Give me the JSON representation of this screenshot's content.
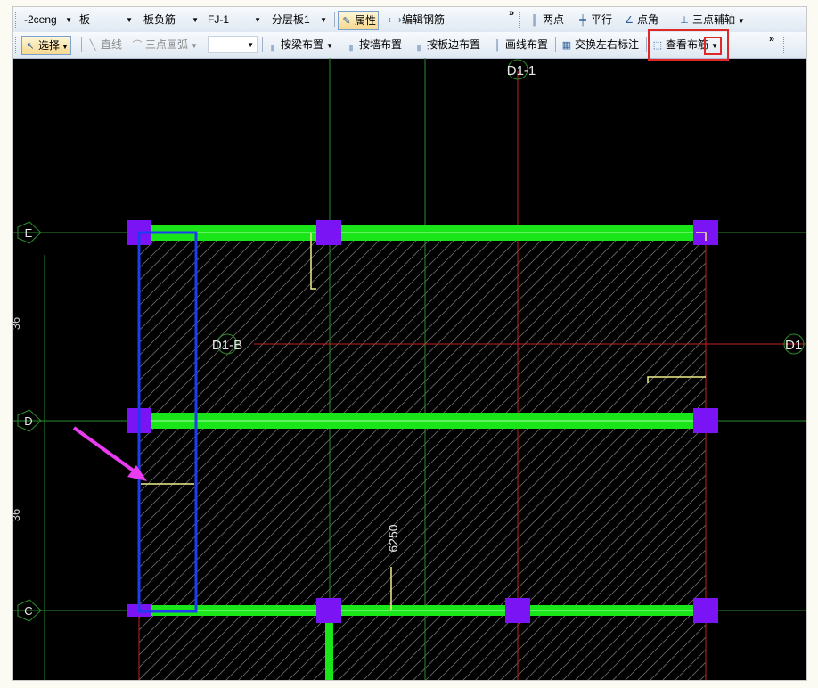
{
  "toolbar1": {
    "floor": "-2ceng",
    "component_type": "板",
    "sub_type": "板负筋",
    "component_name": "FJ-1",
    "layer": "分层板1",
    "properties": "属性",
    "edit_rebar": "编辑钢筋",
    "overflow": "»",
    "two_point": "两点",
    "parallel": "平行",
    "point_angle": "点角",
    "three_point_axis": "三点辅轴"
  },
  "toolbar2": {
    "select": "选择",
    "line": "直线",
    "three_point_arc": "三点画弧",
    "combo_value": "",
    "by_beam": "按梁布置",
    "by_wall": "按墙布置",
    "by_slab_edge": "按板边布置",
    "draw_line": "画线布置",
    "swap_labels": "交换左右标注",
    "view_layout": "查看布筋",
    "overflow": "»"
  },
  "canvas": {
    "axes": {
      "top": "D1-1",
      "middle": "D1-B",
      "right_edge": "D1",
      "row_e": "E",
      "row_d": "D",
      "row_c": "C",
      "dim_top": "36",
      "dim_bottom": "36"
    },
    "dimension": "6250"
  },
  "colors": {
    "canvas_bg": "#000000",
    "beam": "#19e519",
    "column": "#7a14f5",
    "selection": "#1e3cf0",
    "highlight": "#e02828",
    "arrow": "#e93cf0",
    "rebar": "#f0f08c"
  }
}
